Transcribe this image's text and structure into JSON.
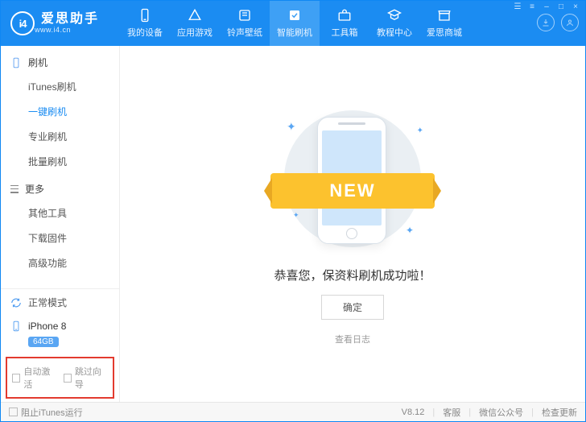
{
  "brand": {
    "name": "爱思助手",
    "url": "www.i4.cn",
    "logo_text": "i4"
  },
  "nav": [
    {
      "label": "我的设备"
    },
    {
      "label": "应用游戏"
    },
    {
      "label": "铃声壁纸"
    },
    {
      "label": "智能刷机",
      "active": true
    },
    {
      "label": "工具箱"
    },
    {
      "label": "教程中心"
    },
    {
      "label": "爱思商城"
    }
  ],
  "sidebar": {
    "group1": {
      "title": "刷机",
      "items": [
        "iTunes刷机",
        "一键刷机",
        "专业刷机",
        "批量刷机"
      ],
      "selected_index": 1
    },
    "group2": {
      "title": "更多",
      "items": [
        "其他工具",
        "下载固件",
        "高级功能"
      ]
    },
    "mode": "正常模式",
    "device": {
      "name": "iPhone 8",
      "storage": "64GB"
    },
    "auto_activate": "自动激活",
    "skip_guide": "跳过向导"
  },
  "main": {
    "ribbon": "NEW",
    "message": "恭喜您，保资料刷机成功啦！",
    "ok": "确定",
    "view_log": "查看日志"
  },
  "footer": {
    "block_itunes": "阻止iTunes运行",
    "version": "V8.12",
    "support": "客服",
    "wechat": "微信公众号",
    "update": "检查更新"
  }
}
